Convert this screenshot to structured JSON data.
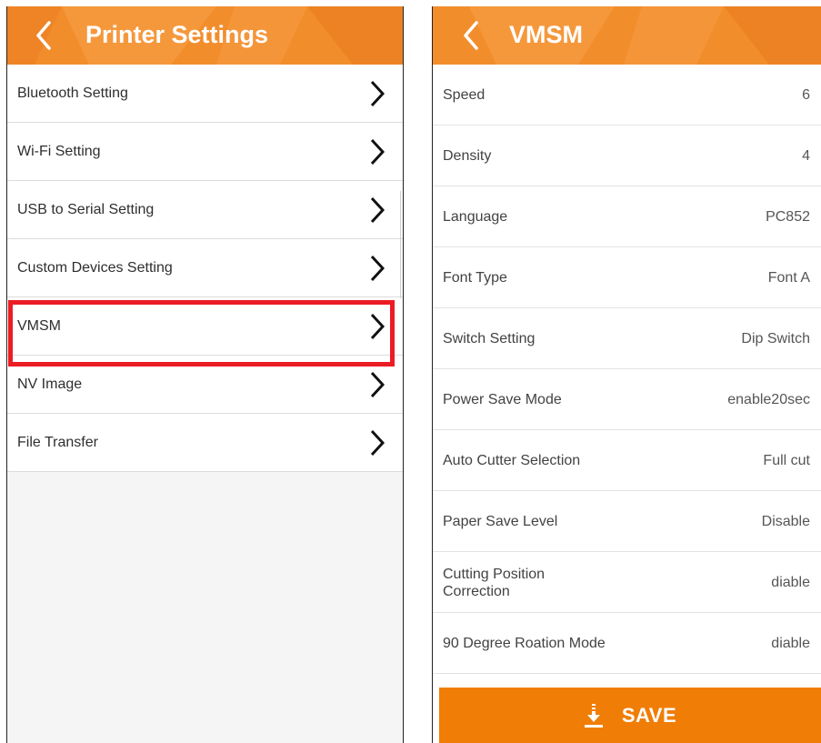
{
  "colors": {
    "header": "#f28d2c",
    "highlight": "#ec1c24",
    "save": "#f07d05"
  },
  "left": {
    "title": "Printer Settings",
    "back_icon": "chevron-left-icon",
    "items": [
      {
        "label": "Bluetooth Setting"
      },
      {
        "label": "Wi-Fi Setting"
      },
      {
        "label": "USB to Serial Setting"
      },
      {
        "label": "Custom Devices Setting"
      },
      {
        "label": "VMSM"
      },
      {
        "label": "NV Image"
      },
      {
        "label": "File Transfer"
      }
    ],
    "highlighted_item": "VMSM"
  },
  "right": {
    "title": "VMSM",
    "back_icon": "chevron-left-icon",
    "settings": [
      {
        "label": "Speed",
        "value": "6"
      },
      {
        "label": "Density",
        "value": "4"
      },
      {
        "label": "Language",
        "value": "PC852"
      },
      {
        "label": "Font Type",
        "value": "Font A"
      },
      {
        "label": "Switch Setting",
        "value": "Dip Switch"
      },
      {
        "label": "Power Save Mode",
        "value": "enable20sec"
      },
      {
        "label": "Auto Cutter Selection",
        "value": "Full cut"
      },
      {
        "label": "Paper Save Level",
        "value": "Disable"
      },
      {
        "label": "Cutting Position Correction",
        "value": "diable"
      },
      {
        "label": "90 Degree Roation Mode",
        "value": "diable"
      }
    ],
    "save_label": "SAVE",
    "save_icon": "download-icon"
  }
}
